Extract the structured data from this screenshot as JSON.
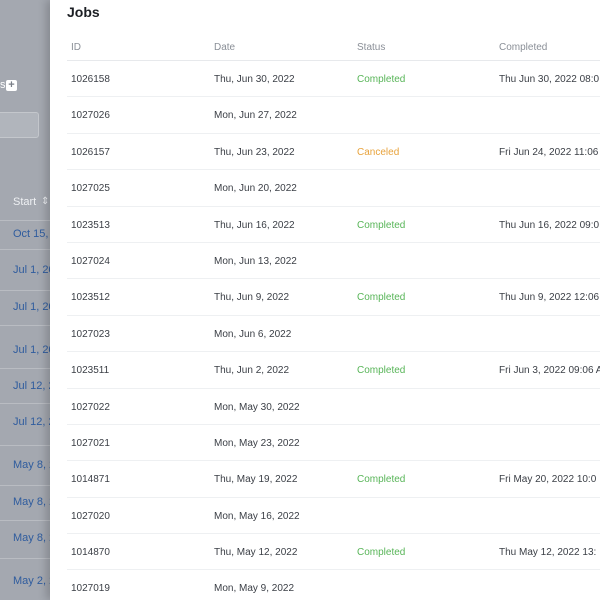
{
  "background": {
    "filter_label": "s",
    "plus_icon": "plus-icon",
    "start_header": "Start",
    "sort_icon": "sort-updown-icon",
    "start_values": [
      "Oct 15,",
      "Jul 1, 20",
      "Jul 1, 20",
      "Jul 1, 20",
      "Jul 12, 2",
      "Jul 12, 2",
      "May 8, 2",
      "May 8, 2",
      "May 8, 2",
      "May 2, 2"
    ]
  },
  "panel": {
    "title": "Jobs",
    "columns": {
      "id": "ID",
      "date": "Date",
      "status": "Status",
      "completed": "Completed"
    },
    "rows": [
      {
        "id": "1026158",
        "date": "Thu, Jun 30, 2022",
        "status": "Completed",
        "completed": "Thu Jun 30, 2022 08:0"
      },
      {
        "id": "1027026",
        "date": "Mon, Jun 27, 2022",
        "status": "",
        "completed": ""
      },
      {
        "id": "1026157",
        "date": "Thu, Jun 23, 2022",
        "status": "Canceled",
        "completed": "Fri Jun 24, 2022 11:06"
      },
      {
        "id": "1027025",
        "date": "Mon, Jun 20, 2022",
        "status": "",
        "completed": ""
      },
      {
        "id": "1023513",
        "date": "Thu, Jun 16, 2022",
        "status": "Completed",
        "completed": "Thu Jun 16, 2022 09:0"
      },
      {
        "id": "1027024",
        "date": "Mon, Jun 13, 2022",
        "status": "",
        "completed": ""
      },
      {
        "id": "1023512",
        "date": "Thu, Jun 9, 2022",
        "status": "Completed",
        "completed": "Thu Jun 9, 2022 12:06"
      },
      {
        "id": "1027023",
        "date": "Mon, Jun 6, 2022",
        "status": "",
        "completed": ""
      },
      {
        "id": "1023511",
        "date": "Thu, Jun 2, 2022",
        "status": "Completed",
        "completed": "Fri Jun 3, 2022 09:06 A"
      },
      {
        "id": "1027022",
        "date": "Mon, May 30, 2022",
        "status": "",
        "completed": ""
      },
      {
        "id": "1027021",
        "date": "Mon, May 23, 2022",
        "status": "",
        "completed": ""
      },
      {
        "id": "1014871",
        "date": "Thu, May 19, 2022",
        "status": "Completed",
        "completed": "Fri May 20, 2022 10:0"
      },
      {
        "id": "1027020",
        "date": "Mon, May 16, 2022",
        "status": "",
        "completed": ""
      },
      {
        "id": "1014870",
        "date": "Thu, May 12, 2022",
        "status": "Completed",
        "completed": "Thu May 12, 2022 13:"
      },
      {
        "id": "1027019",
        "date": "Mon, May 9, 2022",
        "status": "",
        "completed": ""
      }
    ]
  },
  "colors": {
    "completed": "#58b558",
    "canceled": "#e8a33c",
    "link": "#2f5c9e"
  }
}
